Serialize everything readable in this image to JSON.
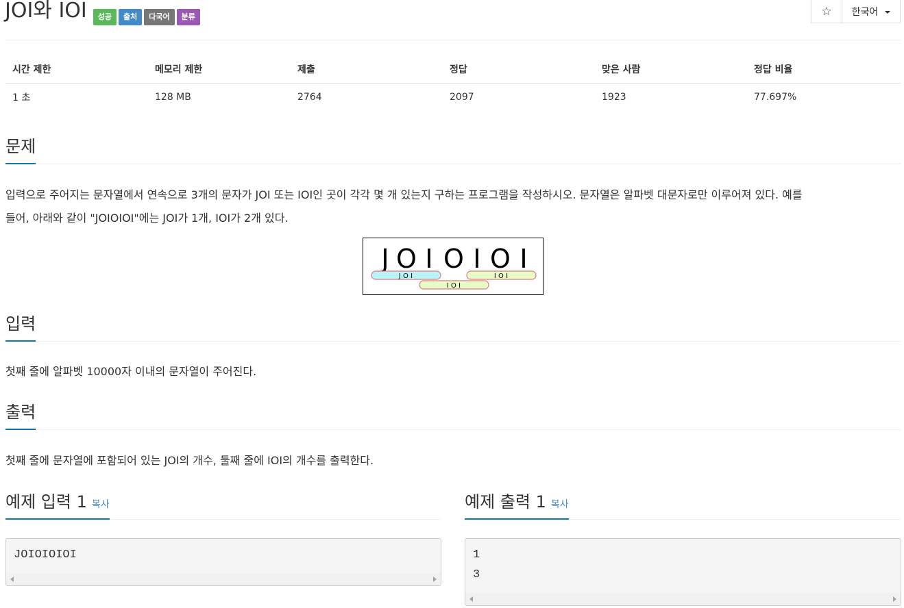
{
  "problem": {
    "title": "JOI와 IOI",
    "badges": [
      "성공",
      "출처",
      "다국어",
      "분류"
    ],
    "badge_colors": [
      "#5cb85c",
      "#428bca",
      "#777777",
      "#9b59b6"
    ]
  },
  "toolbar": {
    "star_icon": "star-icon",
    "star_glyph": "☆",
    "language": "한국어"
  },
  "stats": {
    "headers": [
      "시간 제한",
      "메모리 제한",
      "제출",
      "정답",
      "맞은 사람",
      "정답 비율"
    ],
    "values": [
      "1 초",
      "128 MB",
      "2764",
      "2097",
      "1923",
      "77.697%"
    ]
  },
  "sections": {
    "description": {
      "heading": "문제",
      "text_line1": "입력으로 주어지는 문자열에서 연속으로 3개의 문자가 JOI 또는 IOI인 곳이 각각 몇 개 있는지 구하는 프로그램을 작성하시오. 문자열은 알파벳 대문자로만 이루어져 있다. 예를",
      "text_line2": "들어, 아래와 같이 \"JOIOIOI\"에는 JOI가 1개, IOI가 2개 있다."
    },
    "figure": {
      "letters": [
        "J",
        "O",
        "I",
        "O",
        "I",
        "O",
        "I"
      ],
      "label_joi": "J O I",
      "label_ioi_a": "I O I",
      "label_ioi_b": "I O I",
      "colors": {
        "joi": "#b8f4f8",
        "ioi": "#e8fcc8",
        "outline": "#e07a7a"
      }
    },
    "input": {
      "heading": "입력",
      "text": "첫째 줄에 알파벳 10000자 이내의 문자열이 주어진다."
    },
    "output": {
      "heading": "출력",
      "text": "첫째 줄에 문자열에 포함되어 있는 JOI의 개수, 둘째 줄에 IOI의 개수를 출력한다."
    }
  },
  "samples": {
    "input_heading": "예제 입력 1",
    "output_heading": "예제 출력 1",
    "copy_label": "복사",
    "input_text": "JOIOIOIOI",
    "output_line1": "1",
    "output_line2": "3"
  },
  "colors": {
    "accent": "#0e76a8",
    "link": "#428bca"
  }
}
